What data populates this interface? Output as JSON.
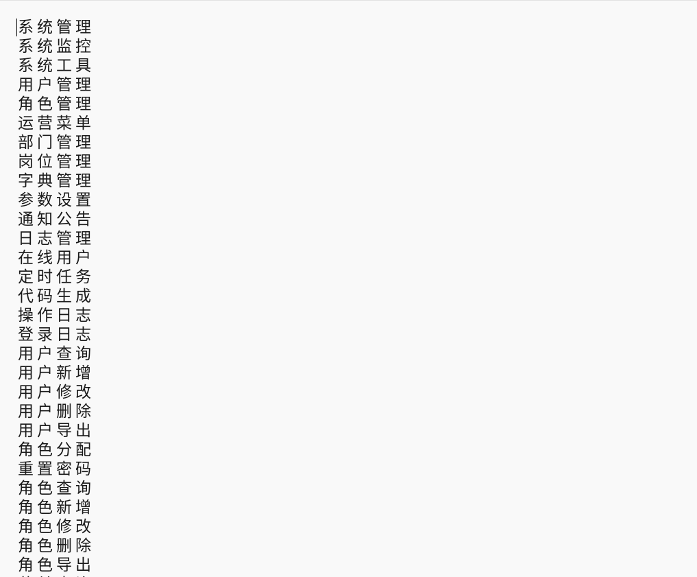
{
  "menu": {
    "items": [
      "系统管理",
      "系统监控",
      "系统工具",
      "用户管理",
      "角色管理",
      "运营菜单",
      "部门管理",
      "岗位管理",
      "字典管理",
      "参数设置",
      "通知公告",
      "日志管理",
      "在线用户",
      "定时任务",
      "代码生成",
      "操作日志",
      "登录日志",
      "用户查询",
      "用户新增",
      "用户修改",
      "用户删除",
      "用户导出",
      "角色分配",
      "重置密码",
      "角色查询",
      "角色新增",
      "角色修改",
      "角色删除",
      "角色导出",
      "菜单查询"
    ]
  }
}
